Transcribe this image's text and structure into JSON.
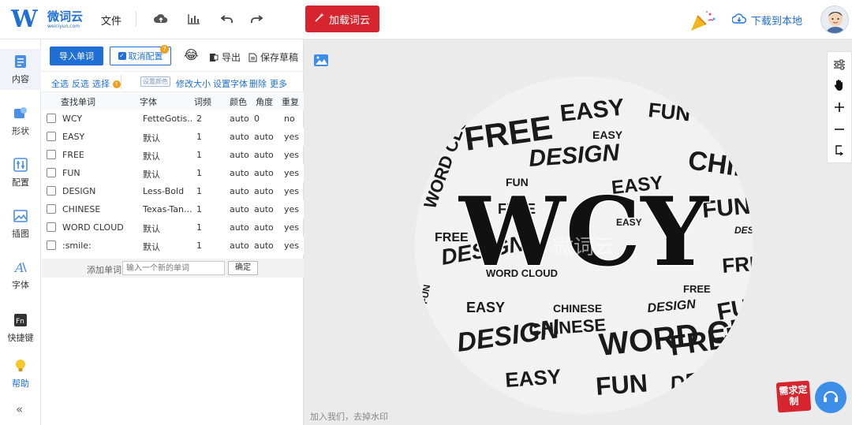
{
  "app": {
    "logo_cn": "微词云",
    "logo_en": "weiciyun.com",
    "menu_file": "文件",
    "load_button": "加载词云",
    "download": "下载到本地"
  },
  "sidebar": {
    "items": [
      {
        "label": "内容",
        "icon": "content-icon"
      },
      {
        "label": "形状",
        "icon": "shape-icon"
      },
      {
        "label": "配置",
        "icon": "config-icon"
      },
      {
        "label": "插图",
        "icon": "illustration-icon"
      },
      {
        "label": "字体",
        "icon": "font-icon"
      },
      {
        "label": "快捷键",
        "icon": "shortcut-icon"
      },
      {
        "label": "帮助",
        "icon": "lightbulb-icon"
      }
    ],
    "collapse": "«"
  },
  "panel": {
    "import": "导入单词",
    "cancel_config": "取消配置",
    "export": "导出",
    "save_draft": "保存草稿",
    "select_all": "全选",
    "invert": "反选",
    "select": "选择",
    "set_color": "设置颜色",
    "resize": "修改大小",
    "set_font": "设置字体",
    "delete": "删除",
    "more": "更多",
    "columns": [
      "查找单词",
      "字体",
      "词频",
      "颜色",
      "角度",
      "重复"
    ],
    "rows": [
      {
        "word": "WCY",
        "font": "FetteGotis...",
        "freq": "2",
        "color": "auto",
        "angle": "0",
        "repeat": "no"
      },
      {
        "word": "EASY",
        "font": "默认",
        "freq": "1",
        "color": "auto",
        "angle": "auto",
        "repeat": "yes"
      },
      {
        "word": "FREE",
        "font": "默认",
        "freq": "1",
        "color": "auto",
        "angle": "auto",
        "repeat": "yes"
      },
      {
        "word": "FUN",
        "font": "默认",
        "freq": "1",
        "color": "auto",
        "angle": "auto",
        "repeat": "yes"
      },
      {
        "word": "DESIGN",
        "font": "Less-Bold",
        "freq": "1",
        "color": "auto",
        "angle": "auto",
        "repeat": "yes"
      },
      {
        "word": "CHINESE",
        "font": "Texas-Tan...",
        "freq": "1",
        "color": "auto",
        "angle": "auto",
        "repeat": "yes"
      },
      {
        "word": "WORD CLOUD",
        "font": "默认",
        "freq": "1",
        "color": "auto",
        "angle": "auto",
        "repeat": "yes"
      },
      {
        "word": ":smile:",
        "font": "默认",
        "freq": "1",
        "color": "auto",
        "angle": "auto",
        "repeat": "yes"
      }
    ],
    "add_word_label": "添加单词",
    "add_word_placeholder": "输入一个新的单词",
    "confirm": "确定"
  },
  "canvas": {
    "watermark_text": "加入我们，去掉水印",
    "promo": "需求定制",
    "cloud_center": "WCY",
    "cloud_watermark": "微词云"
  },
  "colors": {
    "brand": "#1f6fd6",
    "accent_red": "#d7252f"
  }
}
